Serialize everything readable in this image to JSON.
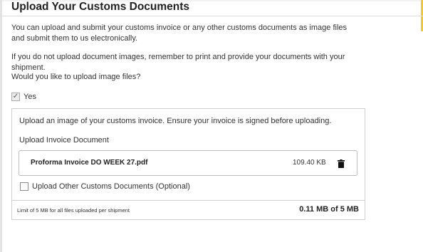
{
  "header": {
    "title": "Upload Your Customs Documents"
  },
  "intro": {
    "paragraph1": "You can upload and submit your customs invoice or any other customs documents as image files and submit them to us electronically.",
    "paragraph2": "If you do not upload document images, remember to print and provide your documents with your shipment.",
    "question": "Would you like to upload image files?"
  },
  "yes_option": {
    "label": "Yes",
    "checked": true
  },
  "upload_panel": {
    "instruction": "Upload an image of your customs invoice. Ensure your invoice is signed before uploading.",
    "section_label": "Upload Invoice Document",
    "file": {
      "name": "Proforma Invoice DO WEEK 27.pdf",
      "size": "109.40 KB",
      "delete_icon": "trash-icon"
    },
    "other_docs": {
      "label": "Upload Other Customs Documents (Optional)",
      "checked": false
    },
    "footer": {
      "limit_note": "Limit of 5 MB for all files uploaded per shipment",
      "usage": "0.11 MB of 5 MB"
    }
  },
  "colors": {
    "accent": "#ffcc00",
    "border": "#cfcfcf"
  }
}
